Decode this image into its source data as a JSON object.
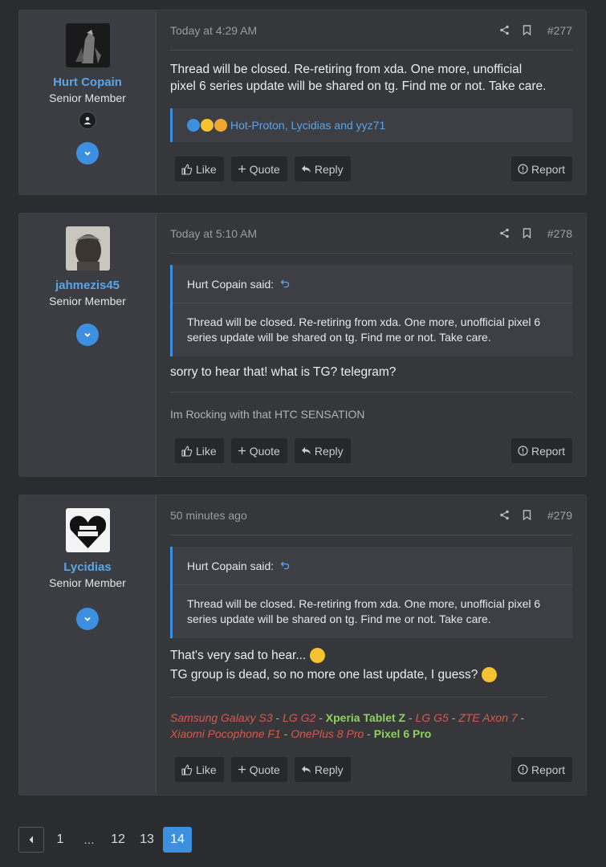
{
  "posts": [
    {
      "username": "Hurt Copain",
      "user_title": "Senior Member",
      "date": "Today at 4:29 AM",
      "number": "#277",
      "message": "Thread will be closed. Re-retiring from xda. One more, unofficial pixel 6 series update will be shared on tg. Find me or not. Take care.",
      "reactions_text": "Hot-Proton, Lycidias and yyz71",
      "actions": {
        "like": "Like",
        "quote": "Quote",
        "reply": "Reply",
        "report": "Report"
      }
    },
    {
      "username": "jahmezis45",
      "user_title": "Senior Member",
      "date": "Today at 5:10 AM",
      "number": "#278",
      "quote_author": "Hurt Copain said:",
      "quote_text": "Thread will be closed. Re-retiring from xda. One more, unofficial pixel 6 series update will be shared on tg. Find me or not. Take care.",
      "message": "sorry to hear that! what is TG? telegram?",
      "signature": "Im Rocking with that HTC SENSATION",
      "actions": {
        "like": "Like",
        "quote": "Quote",
        "reply": "Reply",
        "report": "Report"
      }
    },
    {
      "username": "Lycidias",
      "user_title": "Senior Member",
      "date": "50 minutes ago",
      "number": "#279",
      "quote_author": "Hurt Copain said:",
      "quote_text": "Thread will be closed. Re-retiring from xda. One more, unofficial pixel 6 series update will be shared on tg. Find me or not. Take care.",
      "message_line1": "That's very sad to hear...",
      "message_line2": "TG group is dead, so no more one last update, I guess?",
      "signature": {
        "s1": "Samsung Galaxy S3",
        "s2": "LG G2",
        "s3": "Xperia Tablet Z",
        "s4": "LG G5",
        "s5": "ZTE Axon 7",
        "s6": "Xiaomi Pocophone F1",
        "s7": "OnePlus 8 Pro",
        "s8": "Pixel 6 Pro",
        "sep": " - "
      },
      "actions": {
        "like": "Like",
        "quote": "Quote",
        "reply": "Reply",
        "report": "Report"
      }
    }
  ],
  "pagination": {
    "pages": [
      "1",
      "…",
      "12",
      "13",
      "14"
    ],
    "current": "14"
  },
  "colors": {
    "accent": "#3d8fe0",
    "username": "#5aa4e8",
    "signature_red": "#d65a4c",
    "signature_green": "#8fd25c"
  },
  "icons": [
    "share-icon",
    "bookmark-icon",
    "thumbs-up-icon",
    "plus-icon",
    "reply-icon",
    "report-icon",
    "chevron-down-icon",
    "chevron-left-icon",
    "undo-icon"
  ]
}
